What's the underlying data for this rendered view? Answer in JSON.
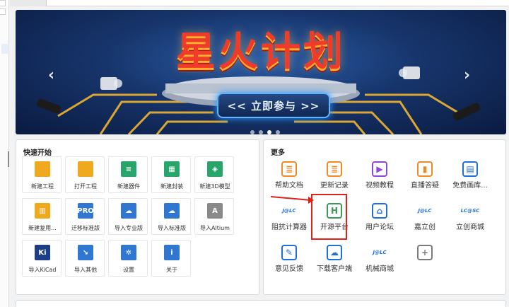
{
  "banner": {
    "title": "星火计划",
    "cta": "<< 立即参与 >>",
    "prev_arrow": "‹",
    "next_arrow": "›"
  },
  "quick_start": {
    "title": "快速开始",
    "tiles": [
      {
        "label": "新建工程",
        "icon": "folder-icon",
        "glyph": ""
      },
      {
        "label": "打开工程",
        "icon": "folder-open-icon",
        "glyph": ""
      },
      {
        "label": "新建器件",
        "icon": "component-icon",
        "glyph": "≡"
      },
      {
        "label": "新建封装",
        "icon": "footprint-icon",
        "glyph": "▦"
      },
      {
        "label": "新建3D模型",
        "icon": "cube-icon",
        "glyph": "◈"
      },
      {
        "label": "新建复用...",
        "icon": "reuse-icon",
        "glyph": "▥"
      },
      {
        "label": "迁移标准版",
        "icon": "migrate-icon",
        "glyph": "PRO"
      },
      {
        "label": "导入专业版",
        "icon": "cloud-pro-icon",
        "glyph": "☁"
      },
      {
        "label": "导入标准版",
        "icon": "cloud-std-icon",
        "glyph": "☁"
      },
      {
        "label": "导入Altium",
        "icon": "altium-icon",
        "glyph": "A"
      },
      {
        "label": "导入KiCad",
        "icon": "kicad-icon",
        "glyph": "Ki"
      },
      {
        "label": "导入其他",
        "icon": "import-more-icon",
        "glyph": "↘"
      },
      {
        "label": "设置",
        "icon": "gear-icon",
        "glyph": "✲"
      },
      {
        "label": "关于",
        "icon": "info-icon",
        "glyph": "i"
      }
    ]
  },
  "more": {
    "title": "更多",
    "items": [
      {
        "label": "帮助文档",
        "icon": "help-doc-icon",
        "glyph": "≣"
      },
      {
        "label": "更新记录",
        "icon": "changelog-icon",
        "glyph": "≣"
      },
      {
        "label": "视频教程",
        "icon": "video-icon",
        "glyph": "▶"
      },
      {
        "label": "直播答疑",
        "icon": "live-icon",
        "glyph": "▮"
      },
      {
        "label": "免费画库...",
        "icon": "library-icon",
        "glyph": "▤"
      },
      {
        "label": "阻抗计算器",
        "icon": "jlc-icon",
        "glyph": "J@LC"
      },
      {
        "label": "开源平台",
        "icon": "oshwhub-icon",
        "glyph": "H"
      },
      {
        "label": "用户论坛",
        "icon": "forum-icon",
        "glyph": "⌂"
      },
      {
        "label": "嘉立创",
        "icon": "jlc-logo-icon",
        "glyph": "J@LC"
      },
      {
        "label": "立创商城",
        "icon": "lcsc-icon",
        "glyph": "LC@SC"
      },
      {
        "label": "意见反馈",
        "icon": "feedback-icon",
        "glyph": "✎"
      },
      {
        "label": "下载客户端",
        "icon": "download-cloud-icon",
        "glyph": "☁"
      },
      {
        "label": "机械商城",
        "icon": "jlc-mall-icon",
        "glyph": "J@LC"
      },
      {
        "label": "",
        "icon": "add-icon",
        "glyph": "+"
      }
    ]
  },
  "colors": {
    "tile_orange": "#f0a81e",
    "tile_green": "#27a56a",
    "tile_blue": "#2f77d1",
    "tile_navy": "#1d3f8a",
    "more_orange": "#f08a26",
    "more_purple": "#8b48d6",
    "more_blue": "#1e6fd9",
    "highlight_red": "#e0201b"
  }
}
